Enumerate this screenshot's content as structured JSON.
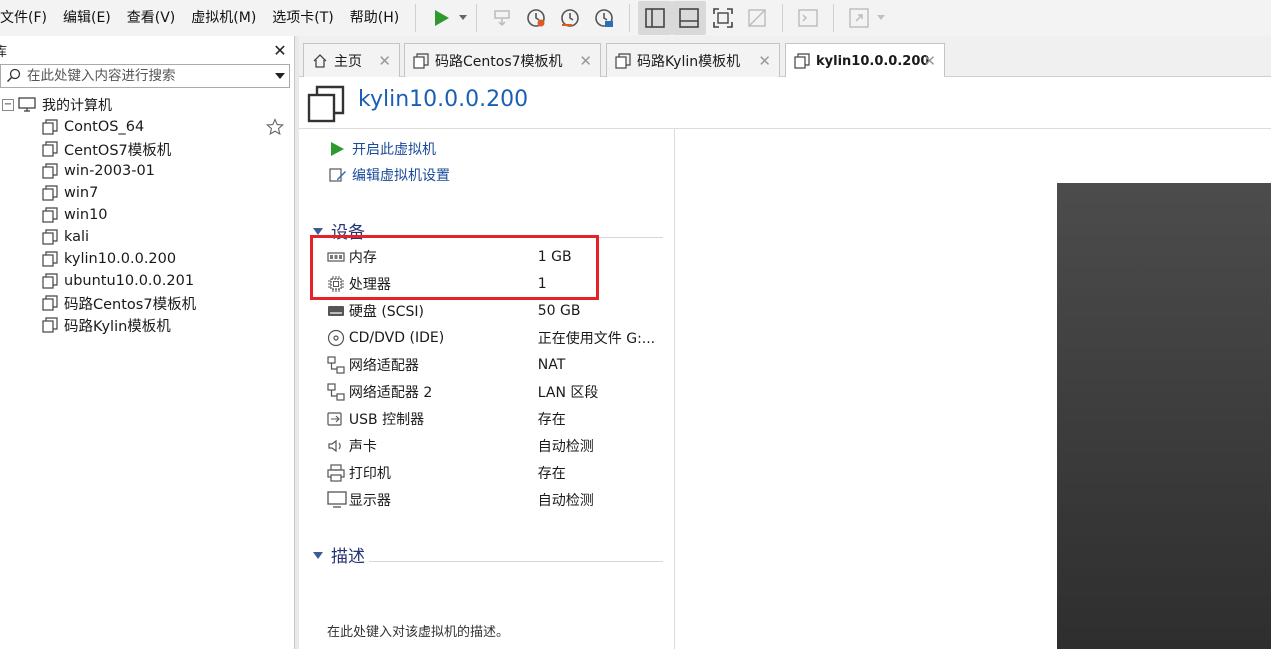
{
  "menu": [
    "文件(F)",
    "编辑(E)",
    "查看(V)",
    "虚拟机(M)",
    "选项卡(T)",
    "帮助(H)"
  ],
  "library": {
    "title": "库",
    "search_placeholder": "在此处键入内容进行搜索",
    "root": "我的计算机",
    "items": [
      "ContOS_64",
      "CentOS7模板机",
      "win-2003-01",
      "win7",
      "win10",
      "kali",
      "kylin10.0.0.200",
      "ubuntu10.0.0.201",
      "码路Centos7模板机",
      "码路Kylin模板机"
    ],
    "selected_index": 6
  },
  "tabs": [
    {
      "label": "主页",
      "icon": "home-icon"
    },
    {
      "label": "码路Centos7模板机",
      "icon": "vm-icon"
    },
    {
      "label": "码路Kylin模板机",
      "icon": "vm-icon"
    },
    {
      "label": "kylin10.0.0.200",
      "icon": "vm-icon",
      "active": true
    }
  ],
  "vm": {
    "title": "kylin10.0.0.200",
    "actions": {
      "power_on": "开启此虚拟机",
      "edit_settings": "编辑虚拟机设置"
    },
    "devices_heading": "设备",
    "devices": [
      {
        "name": "内存",
        "value": "1 GB",
        "icon": "memory-icon"
      },
      {
        "name": "处理器",
        "value": "1",
        "icon": "cpu-icon"
      },
      {
        "name": "硬盘 (SCSI)",
        "value": "50 GB",
        "icon": "disk-icon"
      },
      {
        "name": "CD/DVD (IDE)",
        "value": "正在使用文件 G:...",
        "icon": "cd-icon"
      },
      {
        "name": "网络适配器",
        "value": "NAT",
        "icon": "network-icon"
      },
      {
        "name": "网络适配器 2",
        "value": "LAN 区段",
        "icon": "network-icon"
      },
      {
        "name": "USB 控制器",
        "value": "存在",
        "icon": "usb-icon"
      },
      {
        "name": "声卡",
        "value": "自动检测",
        "icon": "sound-icon"
      },
      {
        "name": "打印机",
        "value": "存在",
        "icon": "printer-icon"
      },
      {
        "name": "显示器",
        "value": "自动检测",
        "icon": "monitor-icon"
      }
    ],
    "description_heading": "描述",
    "description_placeholder": "在此处键入对该虚拟机的描述。"
  },
  "colors": {
    "highlight": "#e52227",
    "title": "#1b5fb5",
    "play": "#2e9a2e"
  }
}
